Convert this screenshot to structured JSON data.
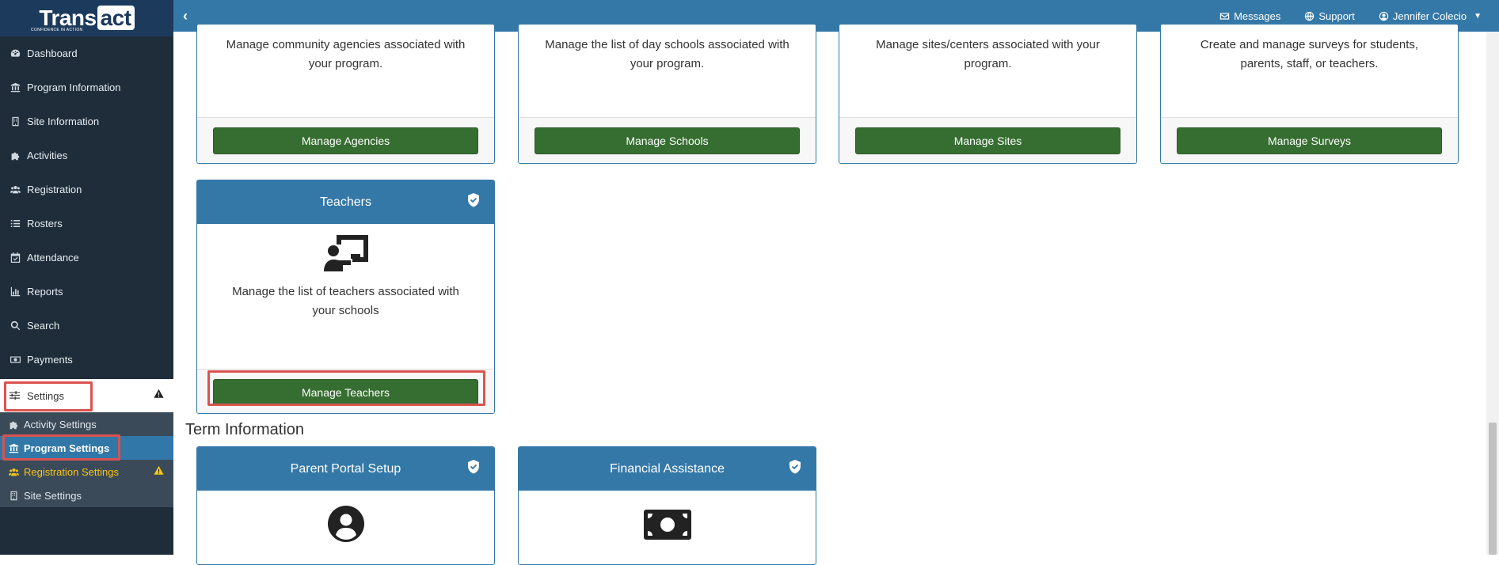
{
  "brand": {
    "name_part1": "Trans",
    "name_part2": "act",
    "tagline": "CONFIDENCE IN ACTION"
  },
  "sidebar": {
    "items": [
      {
        "label": "Dashboard",
        "icon": "tachometer-icon"
      },
      {
        "label": "Program Information",
        "icon": "institution-icon"
      },
      {
        "label": "Site Information",
        "icon": "building-icon"
      },
      {
        "label": "Activities",
        "icon": "puzzle-icon"
      },
      {
        "label": "Registration",
        "icon": "users-icon"
      },
      {
        "label": "Rosters",
        "icon": "list-icon"
      },
      {
        "label": "Attendance",
        "icon": "calendar-check-icon"
      },
      {
        "label": "Reports",
        "icon": "bar-chart-icon"
      },
      {
        "label": "Search",
        "icon": "search-icon"
      },
      {
        "label": "Payments",
        "icon": "money-icon"
      }
    ],
    "settings_label": "Settings",
    "subitems": [
      {
        "label": "Activity Settings",
        "icon": "puzzle-icon"
      },
      {
        "label": "Program Settings",
        "icon": "institution-icon"
      },
      {
        "label": "Registration Settings",
        "icon": "users-icon"
      },
      {
        "label": "Site Settings",
        "icon": "building-icon"
      }
    ]
  },
  "topbar": {
    "messages": "Messages",
    "support": "Support",
    "user": "Jennifer Colecio"
  },
  "cards_top": [
    {
      "desc": "Manage community agencies associated with your program.",
      "button": "Manage Agencies"
    },
    {
      "desc": "Manage the list of day schools associated with your program.",
      "button": "Manage Schools"
    },
    {
      "desc": "Manage sites/centers associated with your program.",
      "button": "Manage Sites"
    },
    {
      "desc": "Create and manage surveys for students, parents, staff, or teachers.",
      "button": "Manage Surveys"
    }
  ],
  "teachers_card": {
    "title": "Teachers",
    "desc": "Manage the list of teachers associated with your schools",
    "button": "Manage Teachers",
    "icon": "chalkboard-teacher-icon"
  },
  "term_section": {
    "title": "Term Information",
    "cards": [
      {
        "title": "Parent Portal Setup",
        "icon": "user-circle-icon"
      },
      {
        "title": "Financial Assistance",
        "icon": "money-bill-icon"
      }
    ]
  },
  "colors": {
    "brand_blue": "#3478a8",
    "sidebar_bg": "#1f2d3a",
    "button_green": "#366e31",
    "highlight_red": "#d9534f",
    "warning_yellow": "#f5c518"
  }
}
